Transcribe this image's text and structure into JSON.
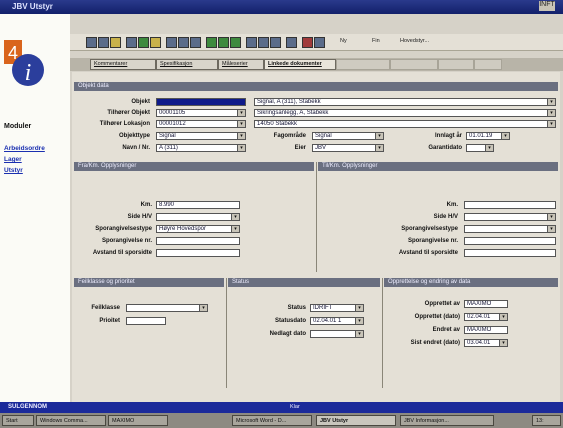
{
  "window": {
    "title": "JBV Utstyr",
    "controls": "INFT"
  },
  "sidebar": {
    "logo_number": "4",
    "logo_letter": "i",
    "title": "Moduler",
    "links": [
      "Arbeidsordre",
      "Lager",
      "Utstyr"
    ]
  },
  "toolbar": {
    "items": [
      "Ny",
      "Fin",
      "Hovedstyr..."
    ]
  },
  "tabs": [
    "Kommentarer",
    "Spesifikasjon",
    "Måleserier",
    "Linkede dokumenter"
  ],
  "objekt": {
    "header": "Objekt data",
    "objekt_label": "Objekt",
    "objekt_code": "",
    "objekt_value": "Signal, A (311), Stabekk",
    "tilhorer_objekt_label": "Tilhører Objekt",
    "tilhorer_objekt_code": "00001105",
    "tilhorer_objekt_value": "Sikringsanlegg, A, Stabekk",
    "tilhorer_lokasjon_label": "Tilhører Lokasjon",
    "tilhorer_lokasjon_code": "00001012",
    "tilhorer_lokasjon_value": "14050 Stabekk",
    "objekttype_label": "Objekttype",
    "objekttype_value": "Signal",
    "fagomrade_label": "Fagområde",
    "fagomrade_value": "Signal",
    "innlagt_label": "Innlagt år",
    "innlagt_value": "01.01.19",
    "navn_label": "Navn / Nr.",
    "navn_value": "A (311)",
    "eier_label": "Eier",
    "eier_value": "JBV",
    "garanti_label": "Garantidato",
    "garanti_value": ""
  },
  "fra": {
    "header": "Fra/Km. Opplysninger",
    "km_label": "Km.",
    "km_value": "8.990",
    "side_label": "Side H/V",
    "side_value": "",
    "spor_label": "Sporangivelsestype",
    "spor_value": "Høyre Hovedspor",
    "spornr_label": "Sporangivelse nr.",
    "spornr_value": "",
    "avstand_label": "Avstand til sporsidte",
    "avstand_value": ""
  },
  "til": {
    "header": "Til/Km. Opplysninger",
    "km_label": "Km.",
    "km_value": "",
    "side_label": "Side H/V",
    "side_value": "",
    "spor_label": "Sporangivelsestype",
    "spor_value": "",
    "spornr_label": "Sporangivelse nr.",
    "spornr_value": "",
    "avstand_label": "Avstand til sporsidte",
    "avstand_value": ""
  },
  "feil": {
    "header": "Feilklasse og prioritet",
    "feilklasse_label": "Feilklasse",
    "feilklasse_value": "",
    "prioritet_label": "Prioitet",
    "prioritet_value": ""
  },
  "status": {
    "header": "Status",
    "status_label": "Status",
    "status_value": "IDRIFT",
    "statusdato_label": "Statusdato",
    "statusdato_value": "02.04.01 1",
    "nedlagt_label": "Nedlagt dato",
    "nedlagt_value": ""
  },
  "opprett": {
    "header": "Opprettelse og endring av data",
    "opprettet_av_label": "Opprettet av",
    "opprettet_av_value": "MAXIMO",
    "opprettet_dato_label": "Opprettet (dato)",
    "opprettet_dato_value": "02.04.01",
    "endret_av_label": "Endret av",
    "endret_av_value": "MAXIMO",
    "sist_endret_label": "Sist endret (dato)",
    "sist_endret_value": "03.04.01"
  },
  "statusbar": {
    "left": "SULGENNOM",
    "center": "Klar"
  },
  "taskbar": {
    "items": [
      "Start",
      "Windows Comma...",
      "MAXIMO",
      "Microsoft Word - D...",
      "JBV Utstyr",
      "JBV Informasjon..."
    ],
    "clock": "13:"
  },
  "colors": {
    "selection": "#0e1a8a",
    "section_header": "#6a6f80",
    "title_bar": "#12206a"
  }
}
